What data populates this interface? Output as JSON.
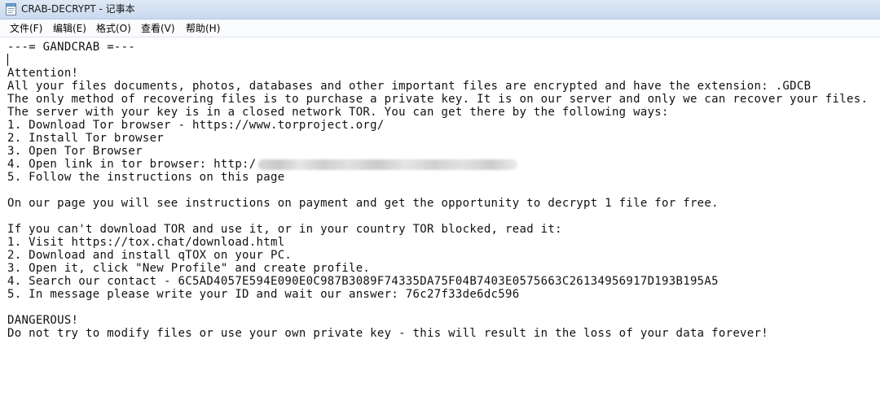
{
  "window": {
    "title": "CRAB-DECRYPT - 记事本",
    "icon": "notepad-icon"
  },
  "menu": {
    "file": "文件(F)",
    "edit": "编辑(E)",
    "format": "格式(O)",
    "view": "查看(V)",
    "help": "帮助(H)"
  },
  "document": {
    "header": "---= GANDCRAB =---",
    "attention": "Attention!",
    "p1": "All your files documents, photos, databases and other important files are encrypted and have the extension: .GDCB",
    "p2": "The only method of recovering files is to purchase a private key. It is on our server and only we can recover your files.",
    "p3": "The server with your key is in a closed network TOR. You can get there by the following ways:",
    "tor_steps": [
      "1. Download Tor browser - https://www.torproject.org/",
      "2. Install Tor browser",
      "3. Open Tor Browser",
      "4. Open link in tor browser: http:/",
      "5. Follow the instructions on this page"
    ],
    "p4": "On our page you will see instructions on payment and get the opportunity to decrypt 1 file for free.",
    "p5": "If you can't download TOR and use it, or in your country TOR blocked, read it:",
    "tox_steps": [
      "1. Visit https://tox.chat/download.html",
      "2. Download and install qTOX on your PC.",
      "3. Open it, click \"New Profile\" and create profile.",
      "4. Search our contact - 6C5AD4057E594E090E0C987B3089F74335DA75F04B7403E0575663C26134956917D193B195A5",
      "5. In message please write your ID and wait our answer: 76c27f33de6dc596"
    ],
    "danger_title": "DANGEROUS!",
    "danger_text": "Do not try to modify files or use your own private key - this will result in the loss of your data forever!"
  }
}
